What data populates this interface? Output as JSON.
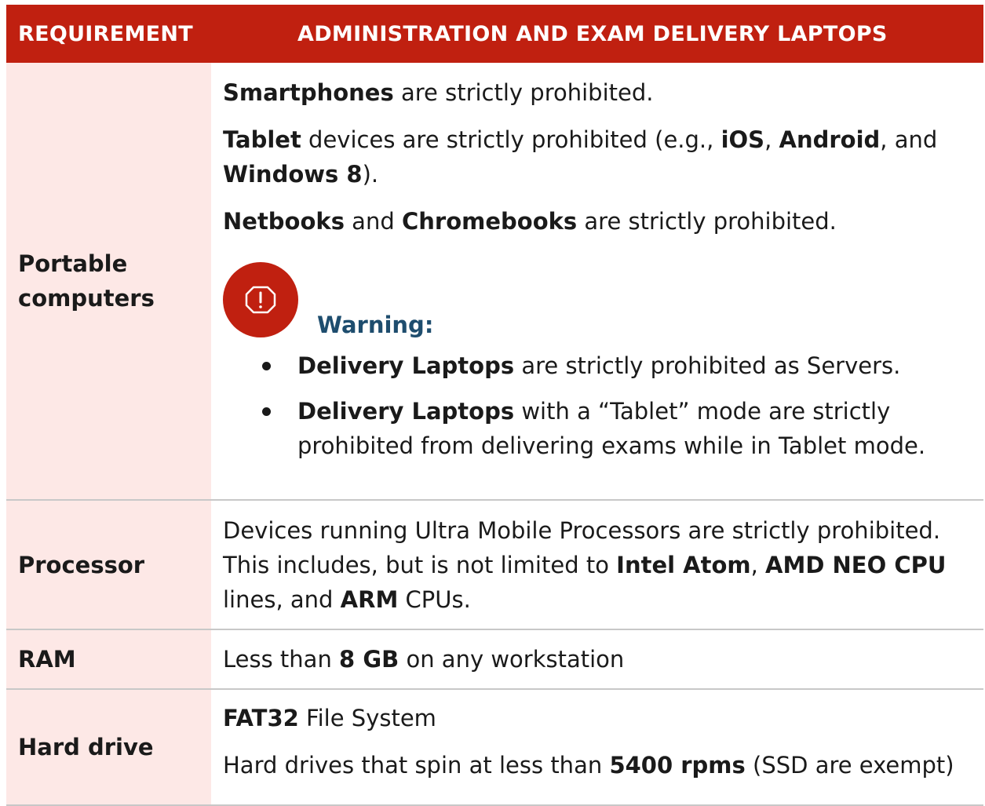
{
  "header": {
    "col1": "REQUIREMENT",
    "col2": "ADMINISTRATION AND EXAM DELIVERY LAPTOPS"
  },
  "colors": {
    "header_bg": "#c02010",
    "requirement_bg": "#fde8e6",
    "warning_label": "#1e4d6e"
  },
  "rows": [
    {
      "requirement_line1": "Portable",
      "requirement_line2": "computers",
      "p1": {
        "b1": "Smartphones",
        "t1": " are strictly prohibited."
      },
      "p2": {
        "b1": "Tablet",
        "t1": " devices are strictly prohibited (e.g., ",
        "b2": "iOS",
        "t2": ", ",
        "b3": "Android",
        "t3": ", and ",
        "b4": "Windows 8",
        "t4": ")."
      },
      "p3": {
        "b1": "Netbooks",
        "t1": " and ",
        "b2": "Chromebooks",
        "t2": " are strictly prohibited."
      },
      "warning": {
        "icon": "warning-octagon-icon",
        "label": "Warning:",
        "bullets": [
          {
            "b": "Delivery Laptops",
            "t": " are strictly prohibited as Servers."
          },
          {
            "b": "Delivery Laptops",
            "t": " with a “Tablet” mode are strictly prohibited from delivering exams while in Tablet mode."
          }
        ]
      }
    },
    {
      "requirement": "Processor",
      "t1": "Devices running Ultra Mobile Processors are strictly prohibited. This includes, but is not limited to ",
      "b1": "Intel Atom",
      "t2": ", ",
      "b2": "AMD NEO CPU",
      "t3": " lines, and ",
      "b3": "ARM",
      "t4": " CPUs."
    },
    {
      "requirement": "RAM",
      "t1": "Less than ",
      "b1": "8 GB",
      "t2": " on any workstation"
    },
    {
      "requirement": "Hard drive",
      "p1": {
        "b1": "FAT32",
        "t1": " File System"
      },
      "p2": {
        "t1": "Hard drives that spin at less than ",
        "b1": "5400 rpms",
        "t2": " (SSD are exempt)"
      }
    }
  ]
}
